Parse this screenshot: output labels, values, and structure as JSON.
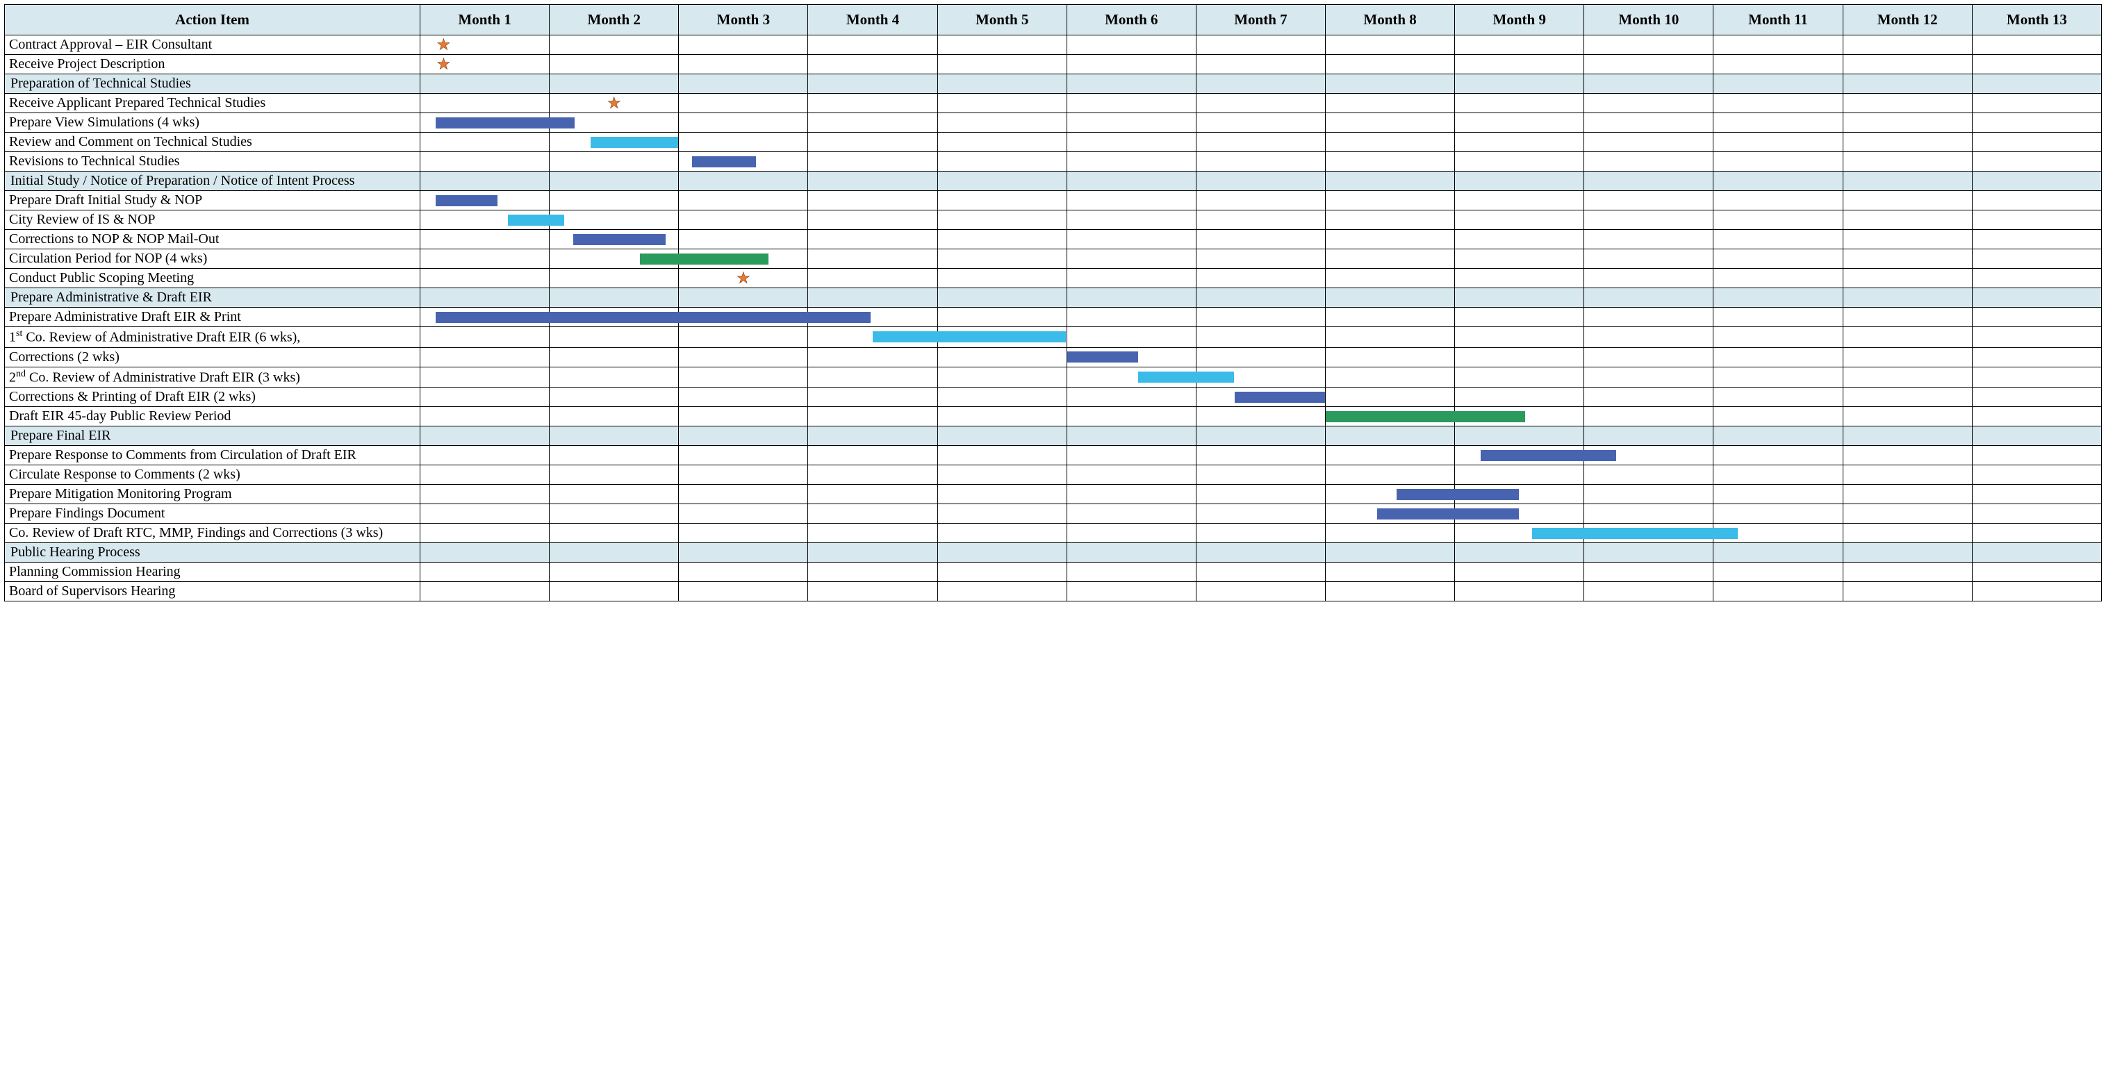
{
  "headers": {
    "action": "Action Item",
    "months": [
      "Month 1",
      "Month 2",
      "Month 3",
      "Month 4",
      "Month 5",
      "Month 6",
      "Month 7",
      "Month 8",
      "Month 9",
      "Month 10",
      "Month 11",
      "Month 12",
      "Month 13"
    ]
  },
  "colors": {
    "blue": "#4863b0",
    "cyan": "#3bbbe8",
    "green": "#2b9a5d",
    "header_bg": "#d7e8ee"
  },
  "rows": [
    {
      "id": "contract-approval",
      "label": "Contract Approval – EIR Consultant",
      "star_month": 1,
      "star_pos": "left"
    },
    {
      "id": "receive-project-description",
      "label": "Receive Project Description",
      "star_month": 1,
      "star_pos": "left"
    },
    {
      "id": "prep-technical-studies",
      "label": "Preparation of Technical Studies",
      "section": true
    },
    {
      "id": "receive-applicant-tech",
      "label": "Receive Applicant Prepared Technical Studies",
      "indent": 1,
      "star_month": 2
    },
    {
      "id": "prepare-view-simulations",
      "label": "Prepare View Simulations (4 wks)",
      "indent": 1,
      "bar": {
        "start_month": 1,
        "start_frac": 0.12,
        "end_month": 2,
        "end_frac": 0.2,
        "color": "blue"
      }
    },
    {
      "id": "review-comment-tech",
      "label": "Review and Comment on Technical Studies",
      "bar": {
        "start_month": 2,
        "start_frac": 0.32,
        "end_month": 3,
        "end_frac": 0.0,
        "color": "cyan"
      }
    },
    {
      "id": "revisions-tech",
      "label": "Revisions to Technical Studies",
      "bar": {
        "start_month": 3,
        "start_frac": 0.1,
        "end_month": 3,
        "end_frac": 0.6,
        "color": "blue"
      }
    },
    {
      "id": "initial-study-nop",
      "label": "Initial Study / Notice of Preparation / Notice of Intent Process",
      "section": true
    },
    {
      "id": "prepare-draft-is-nop",
      "label": "Prepare Draft Initial Study & NOP",
      "bar": {
        "start_month": 1,
        "start_frac": 0.12,
        "end_month": 1,
        "end_frac": 0.6,
        "color": "blue"
      }
    },
    {
      "id": "city-review-is-nop",
      "label": "City Review of IS & NOP",
      "bar": {
        "start_month": 1,
        "start_frac": 0.68,
        "end_month": 2,
        "end_frac": 0.12,
        "color": "cyan"
      }
    },
    {
      "id": "corrections-nop-mailout",
      "label": "Corrections to NOP & NOP Mail-Out",
      "bar": {
        "start_month": 2,
        "start_frac": 0.18,
        "end_month": 2,
        "end_frac": 0.9,
        "color": "blue"
      }
    },
    {
      "id": "circulation-nop",
      "label": "Circulation Period for NOP  (4 wks)",
      "bar": {
        "start_month": 2,
        "start_frac": 0.7,
        "end_month": 3,
        "end_frac": 0.7,
        "color": "green"
      }
    },
    {
      "id": "public-scoping-meeting",
      "label": "Conduct Public Scoping Meeting",
      "star_month": 3
    },
    {
      "id": "prepare-admin-draft-eir",
      "label": "Prepare Administrative & Draft EIR",
      "section": true
    },
    {
      "id": "prepare-admin-draft-print",
      "label": "Prepare Administrative Draft EIR & Print",
      "bar": {
        "start_month": 1,
        "start_frac": 0.12,
        "end_month": 4,
        "end_frac": 0.5,
        "color": "blue"
      }
    },
    {
      "id": "first-co-review",
      "label_html": "1<sup>st</sup> Co. Review of Administrative Draft EIR (6 wks),",
      "bar": {
        "start_month": 4,
        "start_frac": 0.5,
        "end_month": 6,
        "end_frac": 0.0,
        "color": "cyan"
      }
    },
    {
      "id": "corrections-2wks",
      "label": "Corrections (2 wks)",
      "bar": {
        "start_month": 6,
        "start_frac": 0.0,
        "end_month": 6,
        "end_frac": 0.55,
        "color": "blue"
      }
    },
    {
      "id": "second-co-review",
      "label_html": "2<sup>nd</sup> Co. Review of Administrative Draft EIR (3 wks)",
      "bar": {
        "start_month": 6,
        "start_frac": 0.55,
        "end_month": 7,
        "end_frac": 0.3,
        "color": "cyan"
      }
    },
    {
      "id": "corrections-printing-draft",
      "label": "Corrections & Printing of Draft EIR (2 wks)",
      "bar": {
        "start_month": 7,
        "start_frac": 0.3,
        "end_month": 8,
        "end_frac": 0.0,
        "color": "blue"
      }
    },
    {
      "id": "draft-eir-45day",
      "label": "Draft EIR 45-day Public Review Period",
      "bar": {
        "start_month": 8,
        "start_frac": 0.0,
        "end_month": 9,
        "end_frac": 0.55,
        "color": "green"
      }
    },
    {
      "id": "prepare-final-eir",
      "label": "Prepare Final EIR",
      "section": true
    },
    {
      "id": "prepare-response-comments",
      "label": "Prepare Response to Comments from Circulation of Draft EIR",
      "bar": {
        "start_month": 9,
        "start_frac": 0.2,
        "end_month": 10,
        "end_frac": 0.25,
        "color": "blue"
      }
    },
    {
      "id": "circulate-response-comments",
      "label": "Circulate Response to Comments (2 wks)"
    },
    {
      "id": "prepare-mmp",
      "label": "Prepare Mitigation Monitoring Program",
      "bar": {
        "start_month": 8,
        "start_frac": 0.55,
        "end_month": 9,
        "end_frac": 0.5,
        "color": "blue"
      }
    },
    {
      "id": "prepare-findings",
      "label": "Prepare Findings Document",
      "bar": {
        "start_month": 8,
        "start_frac": 0.4,
        "end_month": 9,
        "end_frac": 0.5,
        "color": "blue"
      }
    },
    {
      "id": "co-review-rtc-mmp",
      "label": "Co. Review of Draft RTC, MMP, Findings and Corrections (3 wks)",
      "bar": {
        "start_month": 9,
        "start_frac": 0.6,
        "end_month": 11,
        "end_frac": 0.2,
        "color": "cyan"
      }
    },
    {
      "id": "public-hearing-process",
      "label": "Public Hearing Process",
      "section": true
    },
    {
      "id": "planning-commission-hearing",
      "label": "Planning Commission Hearing"
    },
    {
      "id": "board-supervisors-hearing",
      "label": "Board of Supervisors Hearing"
    }
  ],
  "chart_data": {
    "type": "table",
    "title": "EIR Schedule Gantt Chart",
    "x_unit": "month",
    "x_range": [
      1,
      13
    ],
    "milestones": [
      {
        "task": "Contract Approval – EIR Consultant",
        "month": 1
      },
      {
        "task": "Receive Project Description",
        "month": 1
      },
      {
        "task": "Receive Applicant Prepared Technical Studies",
        "month": 2
      },
      {
        "task": "Conduct Public Scoping Meeting",
        "month": 3
      }
    ],
    "bars": [
      {
        "task": "Prepare View Simulations (4 wks)",
        "start": 1.12,
        "end": 2.2,
        "color": "blue"
      },
      {
        "task": "Review and Comment on Technical Studies",
        "start": 2.32,
        "end": 3.0,
        "color": "cyan"
      },
      {
        "task": "Revisions to Technical Studies",
        "start": 3.1,
        "end": 3.6,
        "color": "blue"
      },
      {
        "task": "Prepare Draft Initial Study & NOP",
        "start": 1.12,
        "end": 1.6,
        "color": "blue"
      },
      {
        "task": "City Review of IS & NOP",
        "start": 1.68,
        "end": 2.12,
        "color": "cyan"
      },
      {
        "task": "Corrections to NOP & NOP Mail-Out",
        "start": 2.18,
        "end": 2.9,
        "color": "blue"
      },
      {
        "task": "Circulation Period for NOP (4 wks)",
        "start": 2.7,
        "end": 3.7,
        "color": "green"
      },
      {
        "task": "Prepare Administrative Draft EIR & Print",
        "start": 1.12,
        "end": 4.5,
        "color": "blue"
      },
      {
        "task": "1st Co. Review of Administrative Draft EIR (6 wks)",
        "start": 4.5,
        "end": 6.0,
        "color": "cyan"
      },
      {
        "task": "Corrections (2 wks)",
        "start": 6.0,
        "end": 6.55,
        "color": "blue"
      },
      {
        "task": "2nd Co. Review of Administrative Draft EIR (3 wks)",
        "start": 6.55,
        "end": 7.3,
        "color": "cyan"
      },
      {
        "task": "Corrections & Printing of Draft EIR (2 wks)",
        "start": 7.3,
        "end": 8.0,
        "color": "blue"
      },
      {
        "task": "Draft EIR 45-day Public Review Period",
        "start": 8.0,
        "end": 9.55,
        "color": "green"
      },
      {
        "task": "Prepare Response to Comments from Circulation of Draft EIR",
        "start": 9.2,
        "end": 10.25,
        "color": "blue"
      },
      {
        "task": "Prepare Mitigation Monitoring Program",
        "start": 8.55,
        "end": 9.5,
        "color": "blue"
      },
      {
        "task": "Prepare Findings Document",
        "start": 8.4,
        "end": 9.5,
        "color": "blue"
      },
      {
        "task": "Co. Review of Draft RTC, MMP, Findings and Corrections (3 wks)",
        "start": 9.6,
        "end": 11.2,
        "color": "cyan"
      }
    ]
  }
}
